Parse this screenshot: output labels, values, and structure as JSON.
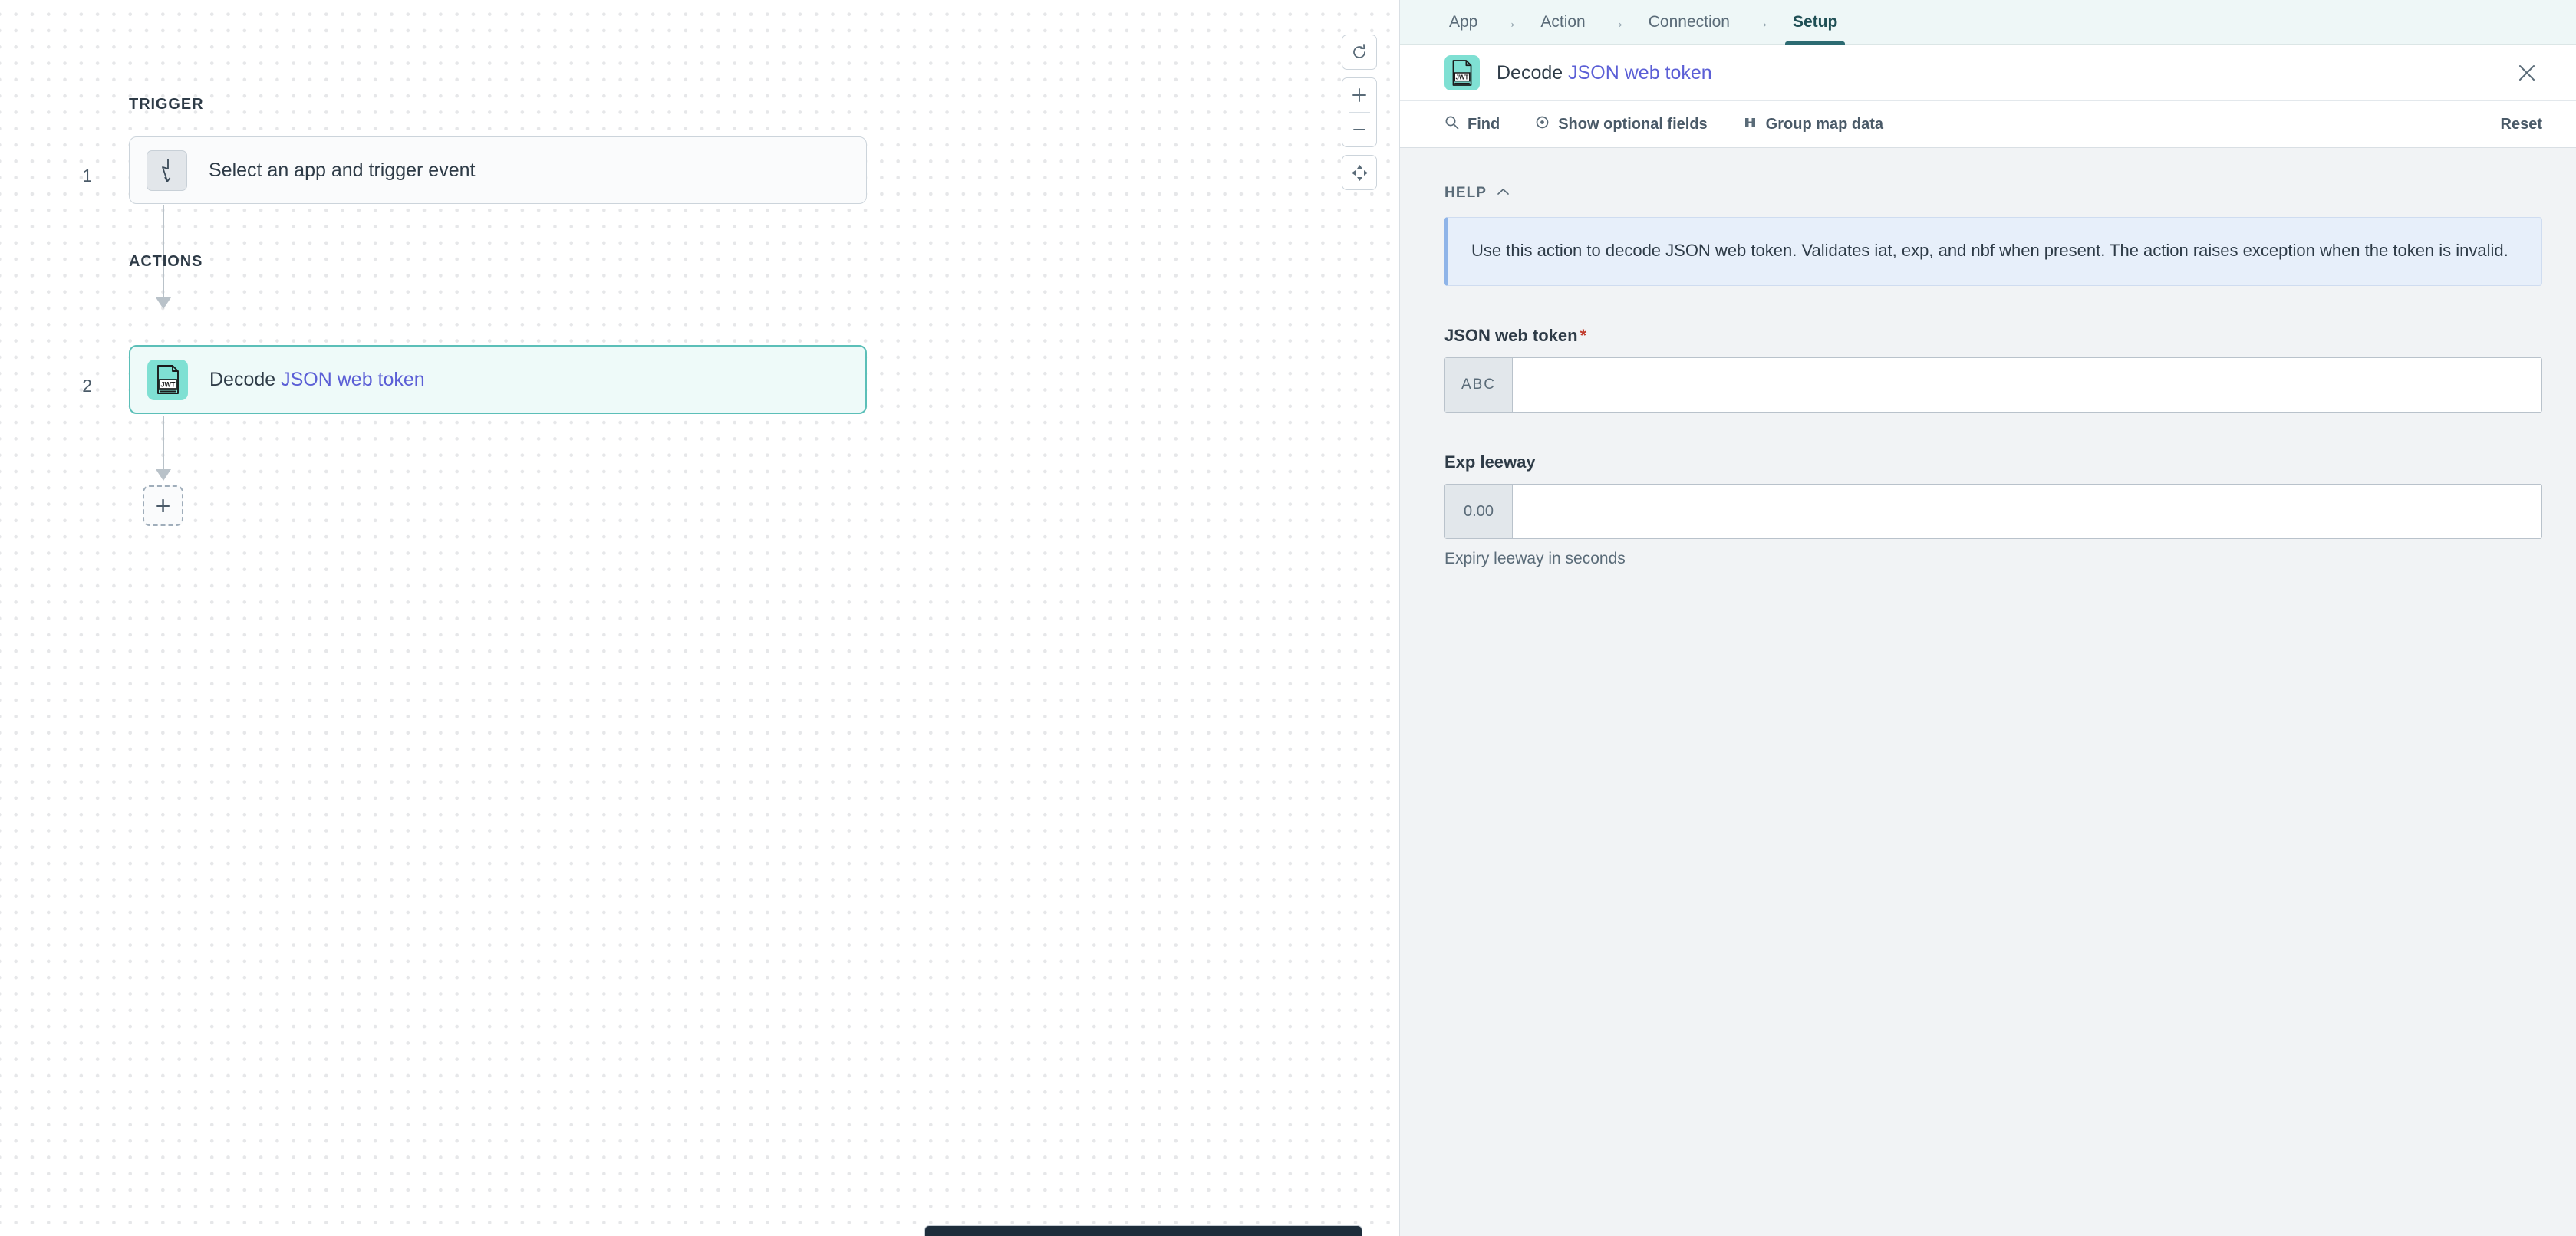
{
  "canvas": {
    "trigger_section_label": "TRIGGER",
    "actions_section_label": "ACTIONS",
    "steps": [
      {
        "number": "1",
        "text": "Select an app and trigger event",
        "icon": "trigger-bolt-icon"
      },
      {
        "number": "2",
        "text_prefix": "Decode ",
        "text_accent": "JSON web token",
        "icon": "jwt-icon"
      }
    ],
    "add_step_label": "+",
    "controls": [
      {
        "name": "reset-view-button",
        "icon": "refresh-icon"
      },
      {
        "name": "zoom-in-button",
        "icon": "plus-icon"
      },
      {
        "name": "zoom-out-button",
        "icon": "minus-icon"
      },
      {
        "name": "fit-to-screen-button",
        "icon": "fit-arrows-icon"
      }
    ],
    "accent_color": "#5bbfb8",
    "link_color": "#5b5fd6"
  },
  "panel": {
    "tabs": [
      {
        "label": "App",
        "active": false
      },
      {
        "label": "Action",
        "active": false
      },
      {
        "label": "Connection",
        "active": false
      },
      {
        "label": "Setup",
        "active": true
      }
    ],
    "tab_separator": "→",
    "header": {
      "title_prefix": "Decode ",
      "title_accent": "JSON web token",
      "icon_text": "JWT",
      "close_label": "×"
    },
    "toolbar": {
      "find_label": "Find",
      "show_optional_label": "Show optional fields",
      "group_map_label": "Group map data",
      "reset_label": "Reset"
    },
    "help": {
      "section_label": "HELP",
      "collapse_icon": "chevron-up-icon",
      "text": "Use this action to decode JSON web token. Validates iat, exp, and nbf when present. The action raises exception when the token is invalid."
    },
    "fields": [
      {
        "label": "JSON web token",
        "required": true,
        "required_marker": "*",
        "type_prefix": "ABC",
        "value": "",
        "hint": ""
      },
      {
        "label": "Exp leeway",
        "required": false,
        "required_marker": "",
        "type_prefix": "0.00",
        "value": "",
        "hint": "Expiry leeway in seconds"
      }
    ],
    "accent_color": "#2c6b72",
    "help_accent_color": "#8fb4e8",
    "required_color": "#c0392b"
  }
}
